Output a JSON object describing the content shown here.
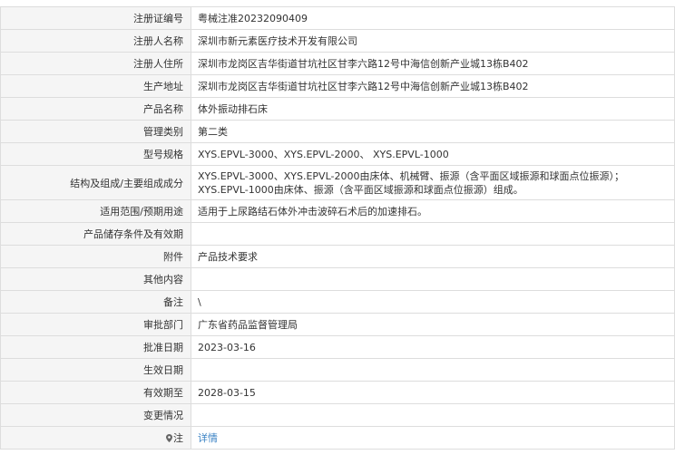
{
  "rows": [
    {
      "label": "注册证编号",
      "value": "粤械注准20232090409"
    },
    {
      "label": "注册人名称",
      "value": "深圳市新元素医疗技术开发有限公司"
    },
    {
      "label": "注册人住所",
      "value": "深圳市龙岗区吉华街道甘坑社区甘李六路12号中海信创新产业城13栋B402"
    },
    {
      "label": "生产地址",
      "value": "深圳市龙岗区吉华街道甘坑社区甘李六路12号中海信创新产业城13栋B402"
    },
    {
      "label": "产品名称",
      "value": "体外振动排石床"
    },
    {
      "label": "管理类别",
      "value": "第二类"
    },
    {
      "label": "型号规格",
      "value": "XYS.EPVL-3000、XYS.EPVL-2000、 XYS.EPVL-1000"
    },
    {
      "label": "结构及组成/主要组成成分",
      "lines": [
        "XYS.EPVL-3000、XYS.EPVL-2000由床体、机械臂、振源（含平面区域振源和球面点位振源）；",
        "XYS.EPVL-1000由床体、振源（含平面区域振源和球面点位振源）组成。"
      ]
    },
    {
      "label": "适用范围/预期用途",
      "value": "适用于上尿路结石体外冲击波碎石术后的加速排石。"
    },
    {
      "label": "产品储存条件及有效期",
      "value": ""
    },
    {
      "label": "附件",
      "value": "产品技术要求"
    },
    {
      "label": "其他内容",
      "value": ""
    },
    {
      "label": "备注",
      "value": "\\"
    },
    {
      "label": "审批部门",
      "value": "广东省药品监督管理局"
    },
    {
      "label": "批准日期",
      "value": "2023-03-16"
    },
    {
      "label": "生效日期",
      "value": ""
    },
    {
      "label": "有效期至",
      "value": "2028-03-15"
    },
    {
      "label": "变更情况",
      "value": ""
    }
  ],
  "note": {
    "label": "注",
    "icon": "location-pin-icon",
    "link": "详情"
  },
  "colors": {
    "label_bg": "#f5f5f5",
    "border": "#dddddd",
    "link": "#3a82c4"
  }
}
